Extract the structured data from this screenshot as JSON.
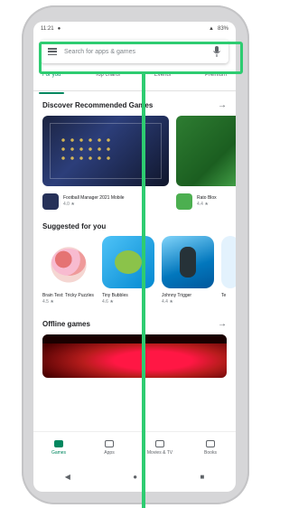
{
  "status_bar": {
    "time": "11:21",
    "right_text": "83%"
  },
  "search": {
    "placeholder": "Search for apps & games"
  },
  "tabs": [
    {
      "label": "For you",
      "active": true
    },
    {
      "label": "Top charts",
      "active": false
    },
    {
      "label": "Events",
      "active": false
    },
    {
      "label": "Premium",
      "active": false
    }
  ],
  "sections": {
    "recommended": {
      "title": "Discover Recommended Games",
      "arrow": "→",
      "cards": [
        {
          "name": "Football Manager 2021 Mobile",
          "sub": "4.0 ★"
        },
        {
          "name": "Rato Blox",
          "sub": "4.4 ★"
        }
      ]
    },
    "suggested": {
      "title": "Suggested for you",
      "apps": [
        {
          "name": "Brain Test: Tricky Puzzles",
          "sub": "4.5 ★"
        },
        {
          "name": "Tiny Bubbles",
          "sub": "4.6 ★"
        },
        {
          "name": "Johnny Trigger",
          "sub": "4.4 ★"
        },
        {
          "name": "Te",
          "sub": ""
        }
      ]
    },
    "offline": {
      "title": "Offline games",
      "arrow": "→"
    }
  },
  "bottom_nav": [
    {
      "label": "Games",
      "active": true
    },
    {
      "label": "Apps",
      "active": false
    },
    {
      "label": "Movies & TV",
      "active": false
    },
    {
      "label": "Books",
      "active": false
    }
  ],
  "system_nav": {
    "back": "◀",
    "home": "●",
    "recent": "■"
  },
  "colors": {
    "accent": "#01875f",
    "highlight": "#2ecc71"
  }
}
